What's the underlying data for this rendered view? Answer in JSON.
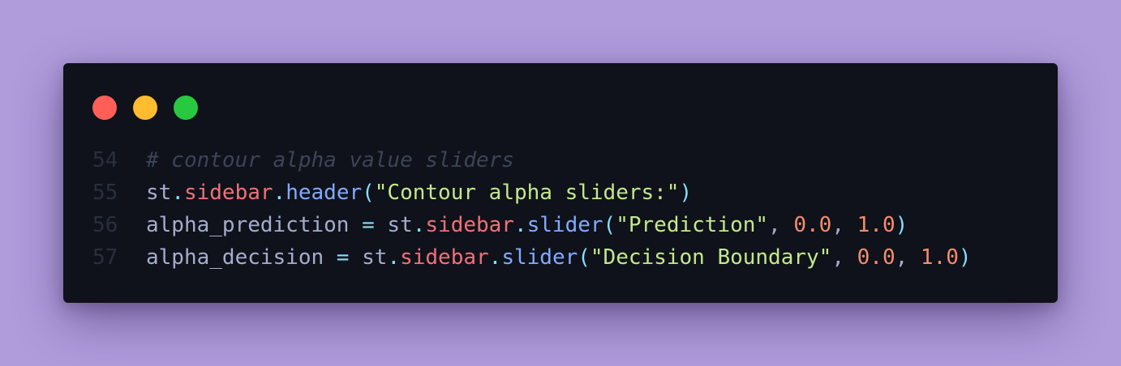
{
  "window": {
    "controls": [
      "close",
      "minimize",
      "maximize"
    ]
  },
  "code": {
    "lines": [
      {
        "number": "54",
        "comment": "# contour alpha value sliders"
      },
      {
        "number": "55",
        "obj": "st",
        "attr": "sidebar",
        "method": "header",
        "string_arg": "\"Contour alpha sliders:\""
      },
      {
        "number": "56",
        "var": "alpha_prediction",
        "obj": "st",
        "attr": "sidebar",
        "method": "slider",
        "string_arg": "\"Prediction\"",
        "min": "0.0",
        "max": "1.0"
      },
      {
        "number": "57",
        "var": "alpha_decision",
        "obj": "st",
        "attr": "sidebar",
        "method": "slider",
        "string_arg": "\"Decision Boundary\"",
        "min": "0.0",
        "max": "1.0"
      }
    ]
  },
  "colors": {
    "background": "#b09cdb",
    "editor": "#0f121a",
    "close": "#ff5f57",
    "minimize": "#febc2e",
    "maximize": "#28c840",
    "comment": "#3d4459",
    "property": "#f07178",
    "function": "#82aaff",
    "string": "#c3e88d",
    "number": "#f78c6c",
    "punctuation": "#89ddff",
    "text": "#a6accd"
  }
}
